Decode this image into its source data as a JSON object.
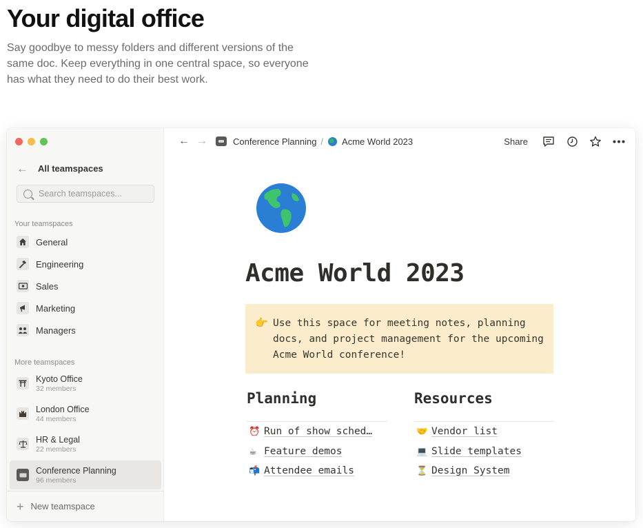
{
  "hero": {
    "title": "Your digital office",
    "subtitle": "Say goodbye to messy folders and different versions of the same doc. Keep everything in one central space, so everyone has what they need to do their best work."
  },
  "sidebar": {
    "back_label": "All teamspaces",
    "search_placeholder": "Search teamspaces...",
    "your_label": "Your teamspaces",
    "your_items": [
      {
        "label": "General",
        "icon": "house-icon"
      },
      {
        "label": "Engineering",
        "icon": "hammer-icon"
      },
      {
        "label": "Sales",
        "icon": "money-icon"
      },
      {
        "label": "Marketing",
        "icon": "megaphone-icon"
      },
      {
        "label": "Managers",
        "icon": "people-icon"
      }
    ],
    "more_label": "More teamspaces",
    "more_items": [
      {
        "label": "Kyoto Office",
        "members": "32 members",
        "icon": "torii-icon"
      },
      {
        "label": "London Office",
        "members": "44 members",
        "icon": "castle-icon"
      },
      {
        "label": "HR & Legal",
        "members": "22 members",
        "icon": "scales-icon"
      },
      {
        "label": "Conference Planning",
        "members": "96 members",
        "icon": "ticket-icon",
        "active": true
      }
    ],
    "new_label": "New teamspace"
  },
  "topbar": {
    "crumb_parent": "Conference Planning",
    "crumb_sep": "/",
    "crumb_current": "Acme World 2023",
    "share_label": "Share"
  },
  "page": {
    "title": "Acme World 2023",
    "callout_emoji": "👉",
    "callout_text": "Use this space for meeting notes, planning docs, and project management for the upcoming Acme World conference!",
    "planning": {
      "heading": "Planning",
      "links": [
        {
          "emoji": "⏰",
          "text": "Run of show sched…"
        },
        {
          "emoji": "☕",
          "text": "Feature demos"
        },
        {
          "emoji": "📬",
          "text": "Attendee emails"
        }
      ]
    },
    "resources": {
      "heading": "Resources",
      "links": [
        {
          "emoji": "🤝",
          "text": "Vendor list"
        },
        {
          "emoji": "💻",
          "text": "Slide templates"
        },
        {
          "emoji": "⏳",
          "text": "Design System"
        }
      ]
    }
  },
  "colors": {
    "callout_bg": "#fbeccb",
    "sidebar_bg": "#f7f7f5",
    "active_bg": "#e8e7e4"
  }
}
